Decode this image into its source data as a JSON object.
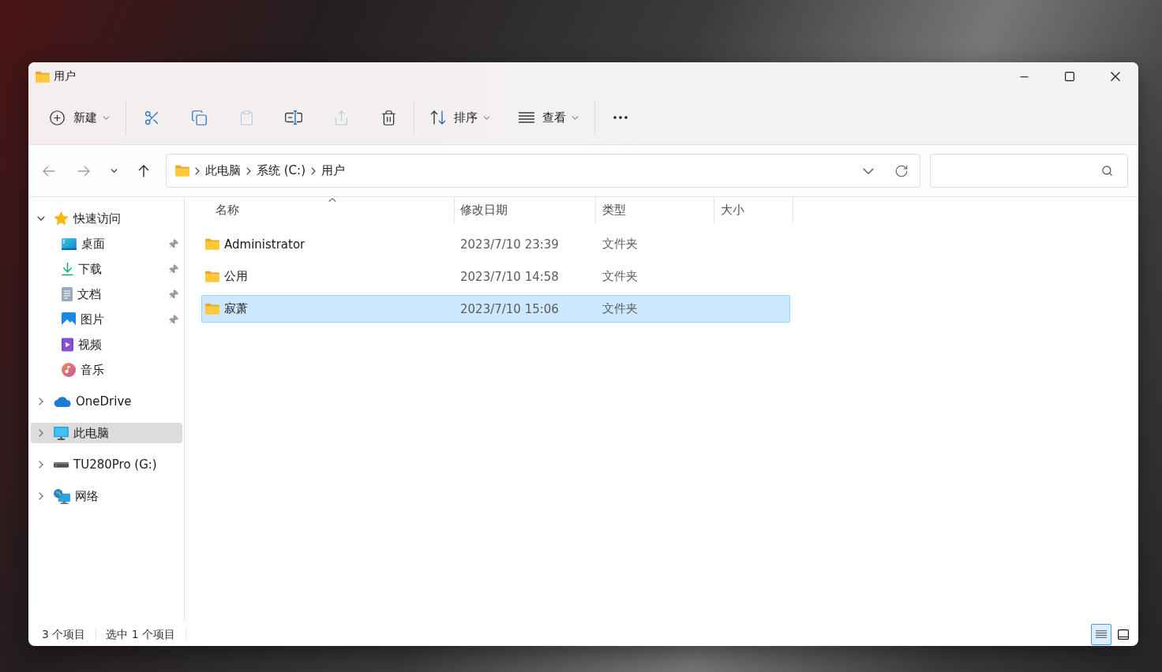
{
  "window": {
    "title": "用户"
  },
  "toolbar": {
    "groups": [
      [
        {
          "kind": "new",
          "label": "新建",
          "disabled": false
        }
      ],
      [
        {
          "kind": "cut",
          "disabled": false
        },
        {
          "kind": "copy",
          "disabled": false
        },
        {
          "kind": "paste",
          "disabled": true
        },
        {
          "kind": "rename",
          "disabled": false
        },
        {
          "kind": "share",
          "disabled": true
        },
        {
          "kind": "delete",
          "disabled": false
        }
      ],
      [
        {
          "kind": "sort",
          "label": "排序",
          "disabled": false
        },
        {
          "kind": "view",
          "label": "查看",
          "disabled": false
        }
      ],
      [
        {
          "kind": "more",
          "disabled": false
        }
      ]
    ]
  },
  "navigation": {
    "buttons": [
      {
        "kind": "back",
        "disabled": true
      },
      {
        "kind": "forward",
        "disabled": true
      },
      {
        "kind": "recent",
        "disabled": false
      },
      {
        "kind": "up",
        "disabled": false
      }
    ]
  },
  "address": {
    "crumbs": [
      "此电脑",
      "系统 (C:)",
      "用户"
    ]
  },
  "sidebar": {
    "items": [
      {
        "kind": "star",
        "label": "快速访问",
        "expanded": true,
        "selected": false,
        "children": [
          {
            "kind": "desktop",
            "label": "桌面",
            "pinned": true,
            "selected": false
          },
          {
            "kind": "download",
            "label": "下载",
            "pinned": true,
            "selected": false
          },
          {
            "kind": "documents",
            "label": "文档",
            "pinned": true,
            "selected": false
          },
          {
            "kind": "pictures",
            "label": "图片",
            "pinned": true,
            "selected": false
          },
          {
            "kind": "videos",
            "label": "视频",
            "pinned": false,
            "selected": false
          },
          {
            "kind": "music",
            "label": "音乐",
            "pinned": false,
            "selected": false
          }
        ]
      },
      {
        "kind": "cloud",
        "label": "OneDrive",
        "expanded": false,
        "selected": false
      },
      {
        "kind": "computer",
        "label": "此电脑",
        "expanded": false,
        "selected": true
      },
      {
        "kind": "drive",
        "label": "TU280Pro (G:)",
        "expanded": false,
        "selected": false
      },
      {
        "kind": "network",
        "label": "网络",
        "expanded": false,
        "selected": false
      }
    ]
  },
  "file_list": {
    "columns": [
      {
        "label": "名称",
        "sorted": true
      },
      {
        "label": "修改日期",
        "sorted": false
      },
      {
        "label": "类型",
        "sorted": false
      },
      {
        "label": "大小",
        "sorted": false
      }
    ],
    "rows": [
      {
        "name": "Administrator",
        "modified": "2023/7/10 23:39",
        "type": "文件夹",
        "selected": false
      },
      {
        "name": "公用",
        "modified": "2023/7/10 14:58",
        "type": "文件夹",
        "selected": false
      },
      {
        "name": "寂萧",
        "modified": "2023/7/10 15:06",
        "type": "文件夹",
        "selected": true
      }
    ]
  },
  "status_bar": {
    "items": [
      "3 个项目",
      "选中 1 个项目"
    ],
    "views": [
      {
        "kind": "details",
        "selected": true
      },
      {
        "kind": "tiles",
        "selected": false
      }
    ]
  }
}
